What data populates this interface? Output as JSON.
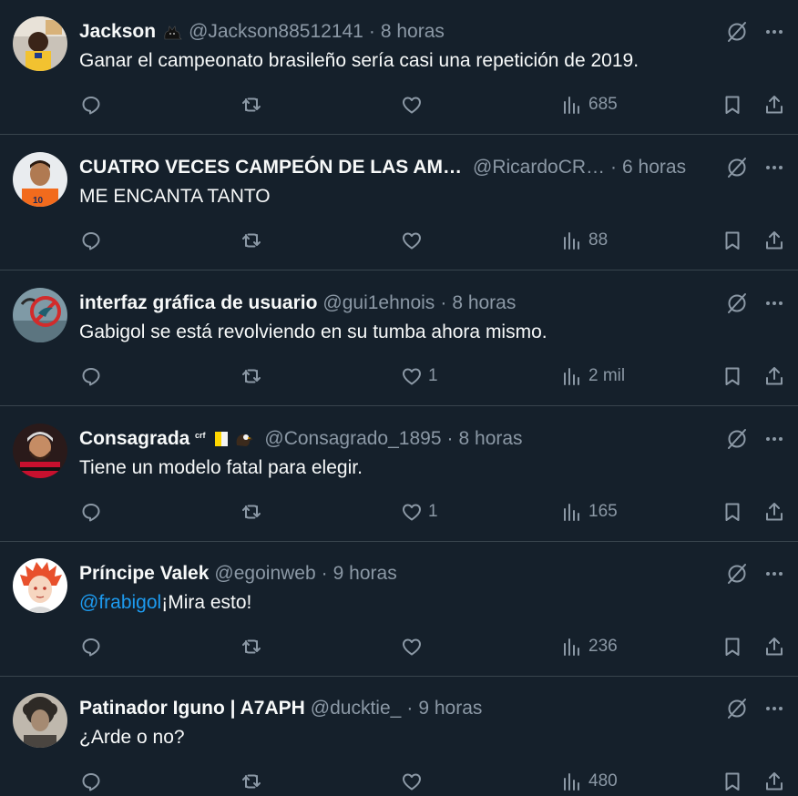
{
  "tweets": [
    {
      "name": "Jackson",
      "name_badge": "🐈‍⬛",
      "handle": "@Jackson88512141",
      "separator": "·",
      "time": "8 horas",
      "text": "Ganar el campeonato brasileño sería casi una repetición de 2019.",
      "mention": "",
      "replies": "",
      "retweets": "",
      "likes": "",
      "views": "685",
      "avatar": "avatar-child-yellow-shirt"
    },
    {
      "name": "CUATRO VECES CAMPEÓN DE LAS AM…",
      "name_badge": "",
      "handle": "@RicardoCR…",
      "separator": "·",
      "time": "6 horas",
      "text": "ME ENCANTA TANTO",
      "mention": "",
      "replies": "",
      "retweets": "",
      "likes": "",
      "views": "88",
      "avatar": "avatar-man-orange-jersey"
    },
    {
      "name": "interfaz gráfica de usuario",
      "name_badge": "",
      "handle": "@gui1ehnois",
      "separator": "·",
      "time": "8 horas",
      "text": "Gabigol se está revolviendo en su tumba ahora mismo.",
      "mention": "",
      "replies": "",
      "retweets": "",
      "likes": "1",
      "views": "2 mil",
      "avatar": "avatar-bird-sign"
    },
    {
      "name": "Consagrada",
      "name_badge": "ᶜʳᶠ 🇻🇦 🦅",
      "handle": "@Consagrado_1895",
      "separator": "·",
      "time": "8 horas",
      "text": "Tiene un modelo fatal para elegir.",
      "mention": "",
      "replies": "",
      "retweets": "",
      "likes": "1",
      "views": "165",
      "avatar": "avatar-player-red-black"
    },
    {
      "name": "Príncipe Valek",
      "name_badge": "",
      "handle": "@egoinweb",
      "separator": "·",
      "time": "9 horas",
      "text": "¡Mira esto!",
      "mention": "@frabigol",
      "replies": "",
      "retweets": "",
      "likes": "",
      "views": "236",
      "avatar": "avatar-drawn-red-hair"
    },
    {
      "name": "Patinador Iguno | A7APH",
      "name_badge": "",
      "handle": "@ducktie_",
      "separator": "·",
      "time": "9 horas",
      "text": "¿Arde o no?",
      "mention": "",
      "replies": "",
      "retweets": "",
      "likes": "",
      "views": "480",
      "avatar": "avatar-curly-hair-photo"
    }
  ],
  "colors": {
    "background": "#15202b",
    "divider": "#38444d",
    "text_primary": "#f7f9f9",
    "text_secondary": "#8b98a5",
    "link": "#1d9bf0"
  }
}
